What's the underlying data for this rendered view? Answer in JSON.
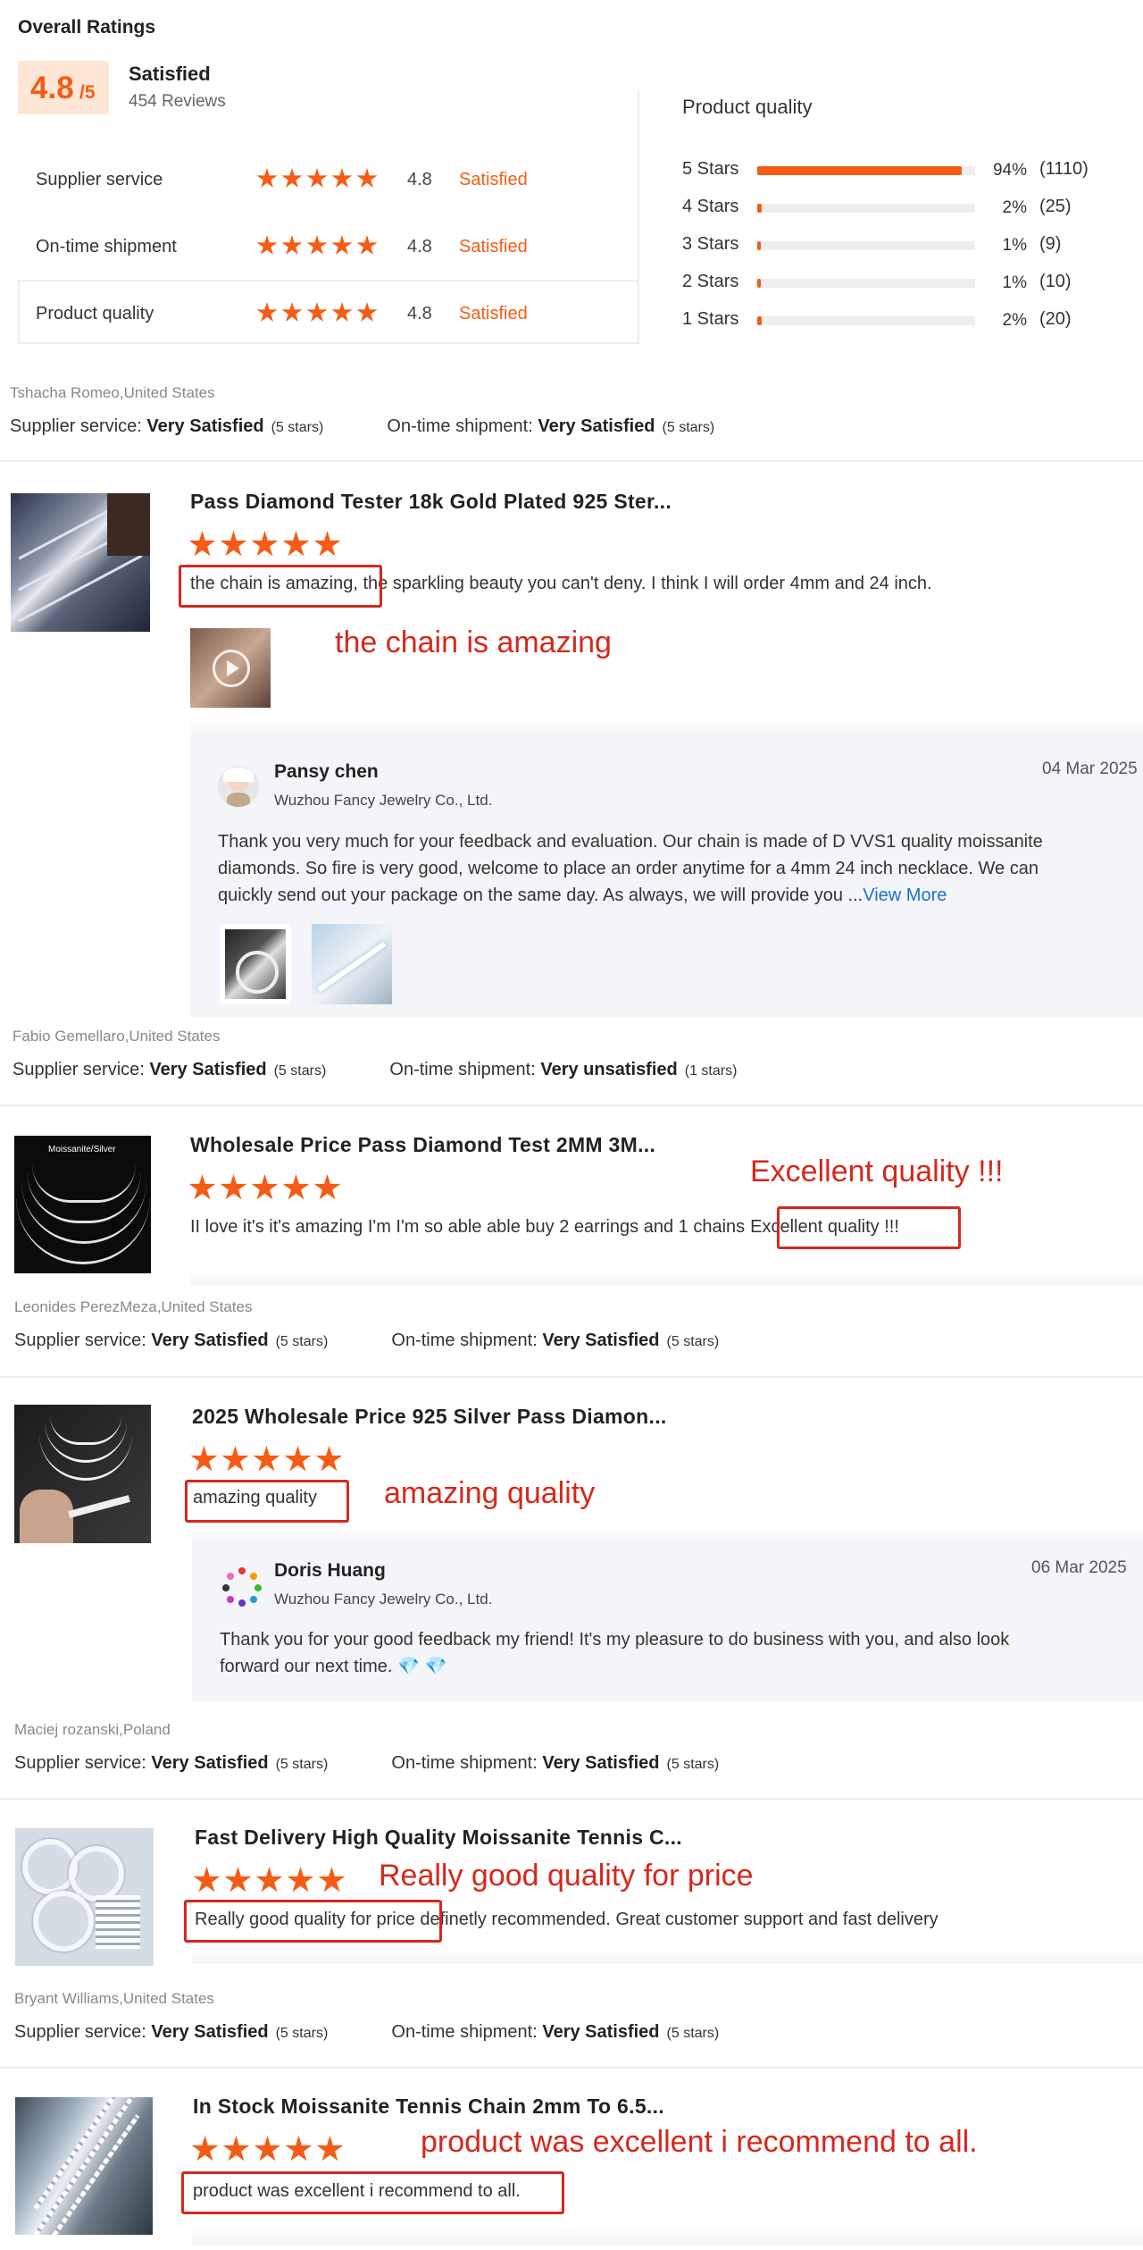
{
  "overall": {
    "title": "Overall Ratings",
    "score": "4.8",
    "out_of": "/5",
    "status": "Satisfied",
    "reviews": "454 Reviews",
    "categories": [
      {
        "label": "Supplier service",
        "score": "4.8",
        "status": "Satisfied",
        "stars": 5
      },
      {
        "label": "On-time shipment",
        "score": "4.8",
        "status": "Satisfied",
        "stars": 5
      },
      {
        "label": "Product quality",
        "score": "4.8",
        "status": "Satisfied",
        "stars": 5
      }
    ]
  },
  "product_quality": {
    "title": "Product quality",
    "rows": [
      {
        "label": "5 Stars",
        "pct": "94%",
        "count": "(1110)",
        "fraction": 0.94
      },
      {
        "label": "4 Stars",
        "pct": "2%",
        "count": "(25)",
        "fraction": 0.02
      },
      {
        "label": "3 Stars",
        "pct": "1%",
        "count": "(9)",
        "fraction": 0.01
      },
      {
        "label": "2 Stars",
        "pct": "1%",
        "count": "(10)",
        "fraction": 0.01
      },
      {
        "label": "1 Stars",
        "pct": "2%",
        "count": "(20)",
        "fraction": 0.02
      }
    ]
  },
  "labels": {
    "supplier_service": "Supplier service:",
    "ontime_shipment": "On-time shipment:"
  },
  "reviews": [
    {
      "reviewer": "Tshacha Romeo,United States",
      "supplier_rating": "Very Satisfied",
      "supplier_stars": "(5 stars)",
      "shipment_rating": "Very Satisfied",
      "shipment_stars": "(5 stars)",
      "product_title": "Pass Diamond Tester 18k Gold Plated 925 Ster...",
      "stars": 5,
      "text_highlight": "the chain is amazing,",
      "text_rest": " the sparkling beauty you can't deny. I think I will order 4mm and 24 inch.",
      "annotation": "the chain is amazing",
      "has_video": true,
      "reply": {
        "name": "Pansy chen",
        "company": "Wuzhou Fancy Jewelry Co., Ltd.",
        "date": "04 Mar 2025",
        "lines": [
          "Thank you very much for your feedback and evaluation. Our chain is made of D VVS1 quality moissanite",
          "diamonds. So fire is very good, welcome to place an order anytime for a 4mm 24 inch necklace. We can",
          "quickly send out your package on the same day. As always, we will provide you ..."
        ],
        "view_more": "View More"
      }
    },
    {
      "reviewer": "Fabio Gemellaro,United States",
      "supplier_rating": "Very Satisfied",
      "supplier_stars": "(5 stars)",
      "shipment_rating": "Very unsatisfied",
      "shipment_stars": "(1 stars)",
      "product_title": "Wholesale Price Pass Diamond Test 2MM 3M...",
      "stars": 5,
      "text_rest": "II love it's it's amazing I'm I'm so able able buy 2 earrings and 1 chains",
      "text_highlight": "Excellent quality !!!",
      "annotation": "Excellent quality !!!",
      "thumb_label": "Moissanite/Silver"
    },
    {
      "reviewer": "Leonides PerezMeza,United States",
      "supplier_rating": "Very Satisfied",
      "supplier_stars": "(5 stars)",
      "shipment_rating": "Very Satisfied",
      "shipment_stars": "(5 stars)",
      "product_title": "2025 Wholesale Price 925 Silver Pass Diamon...",
      "stars": 5,
      "text_highlight": "amazing quality",
      "annotation": "amazing quality",
      "reply": {
        "name": "Doris Huang",
        "company": "Wuzhou Fancy Jewelry Co., Ltd.",
        "date": "06 Mar 2025",
        "lines": [
          "Thank you for your good feedback my friend! It's my pleasure to do business with you, and also look",
          "forward our next time."
        ],
        "emoji": "💎 💎"
      }
    },
    {
      "reviewer": "Maciej rozanski,Poland",
      "supplier_rating": "Very Satisfied",
      "supplier_stars": "(5 stars)",
      "shipment_rating": "Very Satisfied",
      "shipment_stars": "(5 stars)",
      "product_title": "Fast Delivery High Quality Moissanite Tennis C...",
      "stars": 5,
      "text_highlight": "Really good quality for price",
      "text_rest": " definetly recommended. Great customer support and fast delivery",
      "annotation": "Really good quality for price"
    },
    {
      "reviewer": "Bryant Williams,United States",
      "supplier_rating": "Very Satisfied",
      "supplier_stars": "(5 stars)",
      "shipment_rating": "Very Satisfied",
      "shipment_stars": "(5 stars)",
      "product_title": "In Stock Moissanite Tennis Chain 2mm To 6.5...",
      "stars": 5,
      "text_highlight": "product was excellent i recommend to all.",
      "annotation": "product was excellent i recommend to all."
    }
  ],
  "colors": {
    "accent": "#f45c15",
    "annotation_red": "#d6281c",
    "link": "#1a6fd6",
    "reply_bg": "#f4f5f8"
  }
}
